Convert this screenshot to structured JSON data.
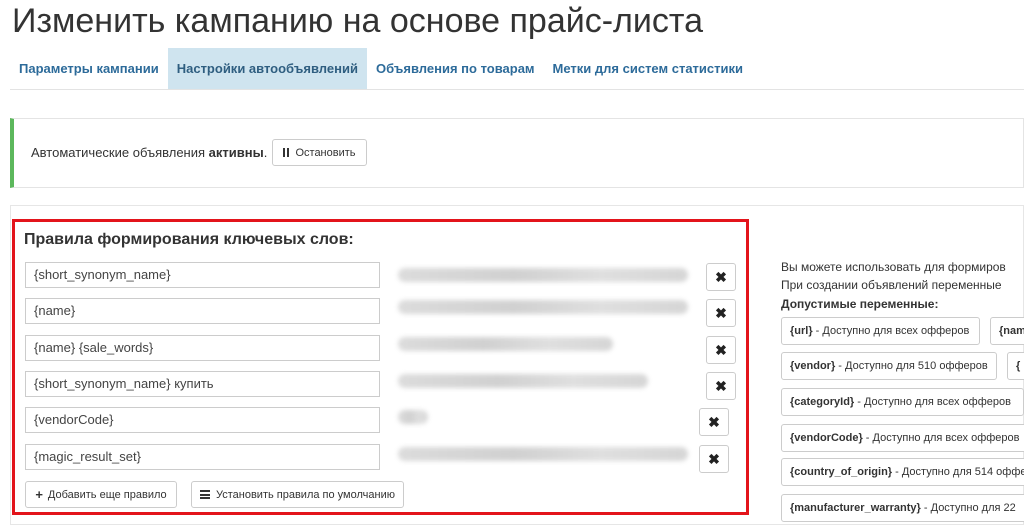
{
  "page_title": "Изменить кампанию на основе прайс-листа",
  "tabs": [
    {
      "label": "Параметры кампании",
      "active": false
    },
    {
      "label": "Настройки автообъявлений",
      "active": true
    },
    {
      "label": "Объявления по товарам",
      "active": false
    },
    {
      "label": "Метки для систем статистики",
      "active": false
    }
  ],
  "status": {
    "text_prefix": "Автоматические объявления",
    "state": "активны",
    "text_suffix": ".",
    "stop_button": "Остановить",
    "accent_color": "#5cb85c"
  },
  "rules": {
    "heading": "Правила формирования ключевых слов:",
    "highlight_color": "#e3141b",
    "items": [
      {
        "value": "{short_synonym_name}",
        "delete_icon": "close-icon"
      },
      {
        "value": "{name}",
        "delete_icon": "close-icon"
      },
      {
        "value": "{name} {sale_words}",
        "delete_icon": "close-icon"
      },
      {
        "value": "{short_synonym_name} купить",
        "delete_icon": "close-icon"
      },
      {
        "value": "{vendorCode}",
        "delete_icon": "close-icon"
      },
      {
        "value": "{magic_result_set}",
        "delete_icon": "close-icon"
      }
    ],
    "add_button": "Добавить еще правило",
    "defaults_button": "Установить правила по умолчанию"
  },
  "help": {
    "line1": "Вы можете использовать для формиров",
    "line2": "При создании объявлений переменные",
    "vars_heading": "Допустимые переменные:",
    "variables": [
      {
        "name": "{url}",
        "desc": " - Доступно для всех офферов"
      },
      {
        "name": "{nam",
        "desc": ""
      },
      {
        "name": "{vendor}",
        "desc": " - Доступно для 510 офферов"
      },
      {
        "name": "{",
        "desc": ""
      },
      {
        "name": "{categoryId}",
        "desc": " - Доступно для всех офферов"
      },
      {
        "name": "{vendorCode}",
        "desc": " - Доступно для всех офферов"
      },
      {
        "name": "{country_of_origin}",
        "desc": " - Доступно для 514 офферов"
      },
      {
        "name": "{manufacturer_warranty}",
        "desc": " - Доступно для 22"
      }
    ]
  }
}
